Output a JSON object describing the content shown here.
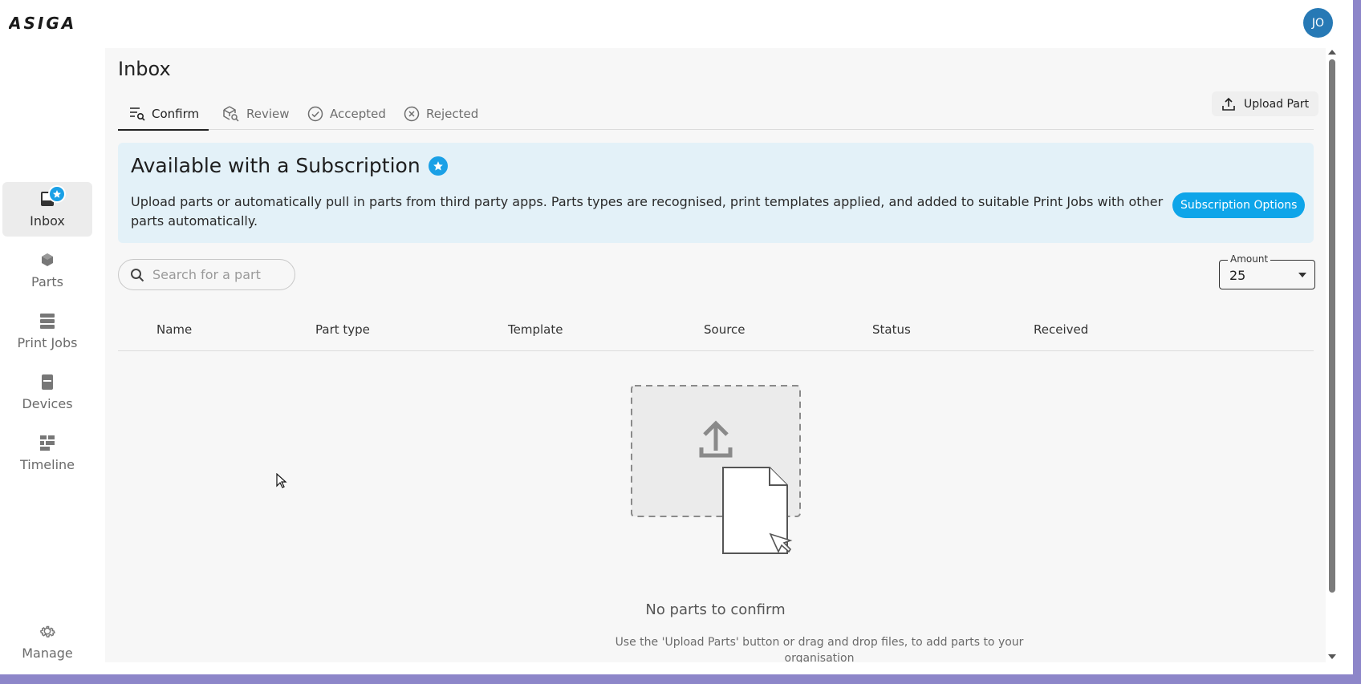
{
  "header": {
    "logo_text": "ASIGA",
    "avatar_initials": "JO"
  },
  "sidebar": {
    "items": [
      {
        "label": "Inbox",
        "icon": "inbox-icon",
        "active": true
      },
      {
        "label": "Parts",
        "icon": "cube-icon"
      },
      {
        "label": "Print Jobs",
        "icon": "stack-icon"
      },
      {
        "label": "Devices",
        "icon": "printer-icon"
      },
      {
        "label": "Timeline",
        "icon": "timeline-icon"
      },
      {
        "label": "Manage",
        "icon": "gear-icon"
      }
    ]
  },
  "page": {
    "title": "Inbox",
    "tabs": [
      {
        "label": "Confirm",
        "active": true,
        "icon": "list-search-icon"
      },
      {
        "label": "Review",
        "icon": "cube-search-icon"
      },
      {
        "label": "Accepted",
        "icon": "check-circle-icon"
      },
      {
        "label": "Rejected",
        "icon": "x-circle-icon"
      }
    ],
    "upload_button": "Upload Part"
  },
  "subscription": {
    "title": "Available with a Subscription",
    "text": "Upload parts or automatically pull in parts from third party apps. Parts types are recognised, print templates applied, and added to suitable Print Jobs with other parts automatically.",
    "button": "Subscription Options"
  },
  "search": {
    "placeholder": "Search for a part"
  },
  "amount": {
    "label": "Amount",
    "value": "25"
  },
  "table": {
    "columns": [
      "Name",
      "Part type",
      "Template",
      "Source",
      "Status",
      "Received"
    ]
  },
  "empty_state": {
    "title": "No parts to confirm",
    "text": "Use the 'Upload Parts' button or drag and drop files, to add parts to your organisation"
  },
  "colors": {
    "accent": "#0ea5e9",
    "avatar": "#2779b5",
    "banner_bg": "#e3f1f8",
    "desktop_bg": "#8d86c9"
  }
}
